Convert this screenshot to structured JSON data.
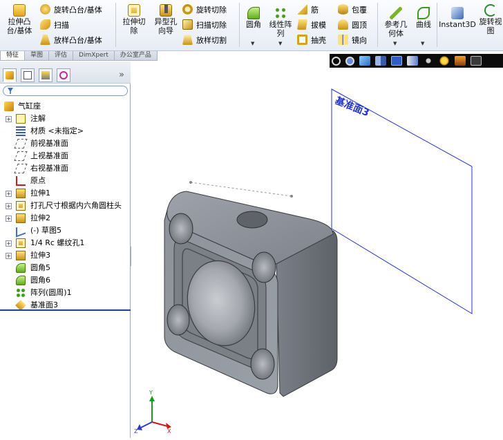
{
  "ribbon": {
    "extrude_boss": "拉伸凸\n台/基体",
    "revolve_boss": "旋转凸台/基体",
    "sweep": "扫描",
    "loft_boss": "放样凸台/基体",
    "extrude_cut": "拉伸切\n除",
    "hole_wizard": "异型孔\n向导",
    "revolve_cut": "旋转切除",
    "sweep_cut": "扫描切除",
    "loft_cut": "放样切割",
    "fillet": "圆角",
    "linear_pattern": "线性阵\n列",
    "rib": "筋",
    "draft": "拔模",
    "shell": "抽壳",
    "wrap": "包覆",
    "dome": "圆顶",
    "mirror": "镜向",
    "ref_geometry": "参考几\n何体",
    "curves": "曲线",
    "instant3d": "Instant3D",
    "rotate_view": "旋转视\n图"
  },
  "tabs": [
    "特征",
    "草图",
    "评估",
    "DimXpert",
    "办公室产品"
  ],
  "panel": {
    "collapse_label": "»",
    "filter_icon": "filter-icon"
  },
  "tree": [
    {
      "label": "气缸座",
      "icon": "part-icon",
      "expand": false,
      "root": true
    },
    {
      "label": "注解",
      "icon": "annotation-icon",
      "expand": true
    },
    {
      "label": "材质 <未指定>",
      "icon": "material-icon",
      "expand": false
    },
    {
      "label": "前视基准面",
      "icon": "plane-icon",
      "expand": false
    },
    {
      "label": "上视基准面",
      "icon": "plane-icon",
      "expand": false
    },
    {
      "label": "右视基准面",
      "icon": "plane-icon",
      "expand": false
    },
    {
      "label": "原点",
      "icon": "origin-icon",
      "expand": false
    },
    {
      "label": "拉伸1",
      "icon": "extrude-icon",
      "expand": true
    },
    {
      "label": "打孔尺寸根据内六角圆柱头",
      "icon": "hole-icon",
      "expand": true
    },
    {
      "label": "拉伸2",
      "icon": "extrude-icon",
      "expand": true
    },
    {
      "label": "(-) 草图5",
      "icon": "sketch-icon",
      "expand": false
    },
    {
      "label": "1/4 Rc 螺纹孔1",
      "icon": "hole-icon",
      "expand": true
    },
    {
      "label": "拉伸3",
      "icon": "extrude-icon",
      "expand": true
    },
    {
      "label": "圆角5",
      "icon": "fillet-icon",
      "expand": false
    },
    {
      "label": "圆角6",
      "icon": "fillet-icon",
      "expand": false
    },
    {
      "label": "阵列(圆周)1",
      "icon": "pattern-icon",
      "expand": false
    },
    {
      "label": "基准面3",
      "icon": "plane3-icon",
      "expand": false
    }
  ],
  "viewport": {
    "plane_label": "基准面3",
    "triad": {
      "x": "X",
      "y": "Y",
      "z": "Z"
    }
  },
  "colors": {
    "plane": "#2233cc",
    "body": "#8f939b",
    "hud": "#0c0c0c",
    "rollback": "#1d3e9c"
  }
}
